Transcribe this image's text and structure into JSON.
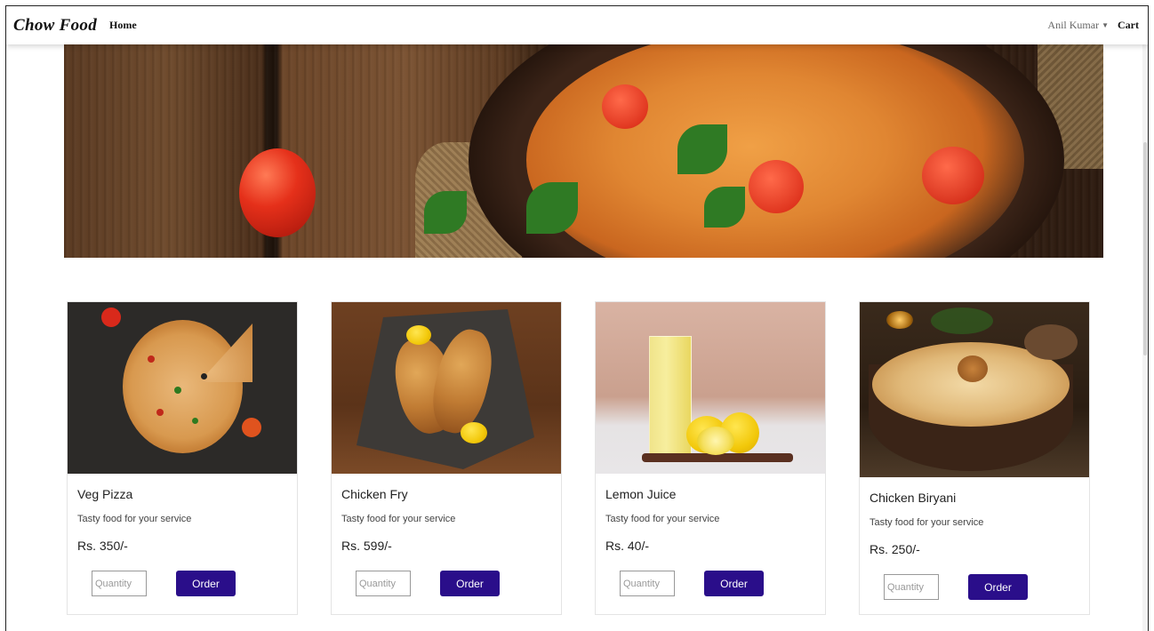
{
  "navbar": {
    "brand": "Chow Food",
    "home_label": "Home",
    "user_name": "Anil Kumar",
    "cart_label": "Cart"
  },
  "products": [
    {
      "title": "Veg Pizza",
      "description": "Tasty food for your service",
      "price": "Rs. 350/-",
      "quantity_placeholder": "Quantity",
      "order_label": "Order"
    },
    {
      "title": "Chicken Fry",
      "description": "Tasty food for your service",
      "price": "Rs. 599/-",
      "quantity_placeholder": "Quantity",
      "order_label": "Order"
    },
    {
      "title": "Lemon Juice",
      "description": "Tasty food for your service",
      "price": "Rs. 40/-",
      "quantity_placeholder": "Quantity",
      "order_label": "Order"
    },
    {
      "title": "Chicken Biryani",
      "description": "Tasty food for your service",
      "price": "Rs. 250/-",
      "quantity_placeholder": "Quantity",
      "order_label": "Order"
    }
  ],
  "colors": {
    "order_button": "#2a0e8a",
    "navbar_bg": "#ffffff"
  },
  "icons": {
    "user_dropdown": "caret-down-icon"
  }
}
